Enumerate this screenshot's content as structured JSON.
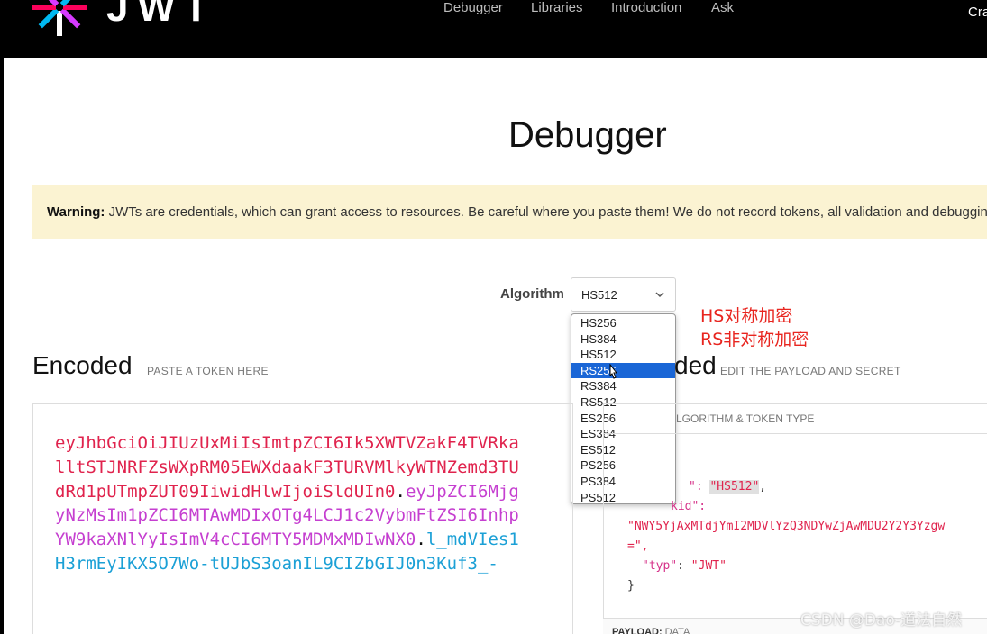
{
  "header": {
    "brand": "JWT",
    "nav": [
      "Debugger",
      "Libraries",
      "Introduction",
      "Ask"
    ],
    "right_text": "Cra"
  },
  "page_title": "Debugger",
  "warning": {
    "label": "Warning:",
    "text": " JWTs are credentials, which can grant access to resources. Be careful where you paste them! We do not record tokens, all validation and debugging is d"
  },
  "algorithm": {
    "label": "Algorithm",
    "selected": "HS512",
    "options": [
      "HS256",
      "HS384",
      "HS512",
      "RS256",
      "RS384",
      "RS512",
      "ES256",
      "ES384",
      "ES512",
      "PS256",
      "PS384",
      "PS512"
    ],
    "highlighted": "RS256"
  },
  "annotations": {
    "line1": "HS对称加密",
    "line2": "RS非对称加密",
    "color": "#e8251f"
  },
  "encoded": {
    "heading": "Encoded",
    "hint": "PASTE A TOKEN HERE",
    "header_part": "eyJhbGciOiJIUzUxMiIsImtpZCI6Ik5XWTVZakF4TVRkalltSTJNRFZsWXpRM05EWXdaakF3TURVMlkyWTNZemd3TUdRd1pUTmpZUT09IiwidHlwIjoiSldUIn0",
    "payload_part": "eyJpZCI6MjgyNzMsIm1pZCI6MTAwMDIxOTg4LCJ1c2VybmFtZSI6InhpYW9kaXNlYyIsImV4cCI6MTY5MDMxMDIwNX0",
    "signature_part": "l_mdVIes1H3rmEyIKX5O7Wo-tUJbS3oanIL9CIZbGIJ0n3Kuf3_-",
    "dot": ".",
    "colors": {
      "header": "#e0234d",
      "payload": "#c53fd0",
      "signature": "#1ba0d6"
    }
  },
  "decoded": {
    "heading": "ded",
    "hint": "EDIT THE PAYLOAD AND SECRET",
    "header_label": "LGORITHM & TOKEN TYPE",
    "json": {
      "alg_key_tail": "\": ",
      "alg_value": "\"HS512\"",
      "alg_comma": ",",
      "kid_key": "kid\":",
      "kid_value": "\"NWY5YjAxMTdjYmI2MDVlYzQ3NDYwZjAwMDU2Y2Y3Yzgw",
      "kid_tail": "=\",",
      "typ_key": "\"typ\"",
      "typ_colon": ": ",
      "typ_value": "\"JWT\"",
      "close": "}"
    },
    "payload_label": "PAYLOAD:",
    "payload_label_sub": " DATA"
  },
  "watermark": "CSDN @Dao-道法自然"
}
